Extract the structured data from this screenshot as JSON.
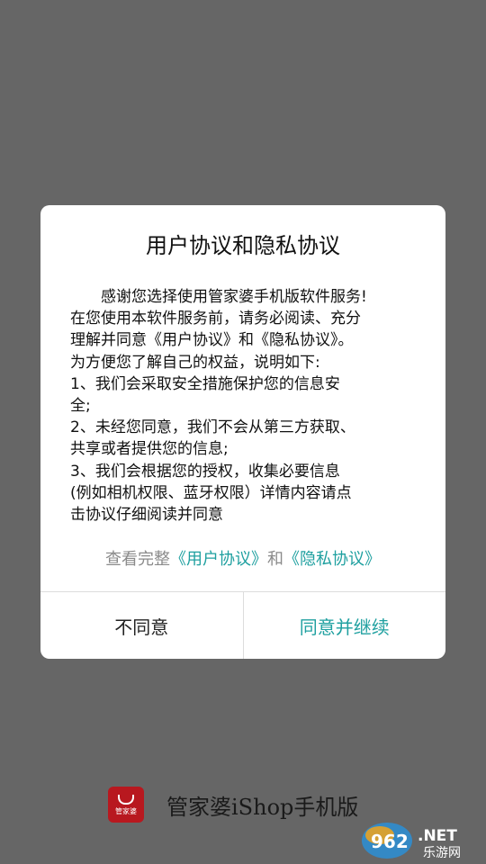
{
  "dialog": {
    "title": "用户协议和隐私协议",
    "body_lines": [
      "感谢您选择使用管家婆手机版软件服务!",
      "在您使用本软件服务前，请务必阅读、充分",
      "理解并同意《用户协议》和《隐私协议》。",
      "为方便您了解自己的权益，说明如下:",
      "1、我们会采取安全措施保护您的信息安",
      "全;",
      "2、未经您同意，我们不会从第三方获取、",
      "共享或者提供您的信息;",
      "3、我们会根据您的授权，收集必要信息",
      "(例如相机权限、蓝牙权限）详情内容请点",
      "击协议仔细阅读并同意"
    ],
    "view_full_prefix": "查看完整",
    "user_agreement_link": "《用户协议》",
    "and_text": "和",
    "privacy_link": "《隐私协议》",
    "disagree_label": "不同意",
    "agree_label": "同意并继续"
  },
  "footer": {
    "logo_text": "管家婆",
    "app_name": "管家婆iShop手机版"
  },
  "watermark": {
    "number": "962",
    "suffix": ".NET",
    "site": "乐游网"
  },
  "colors": {
    "overlay": "#666666",
    "accent": "#1fa0a0",
    "logo": "#b8181f"
  }
}
